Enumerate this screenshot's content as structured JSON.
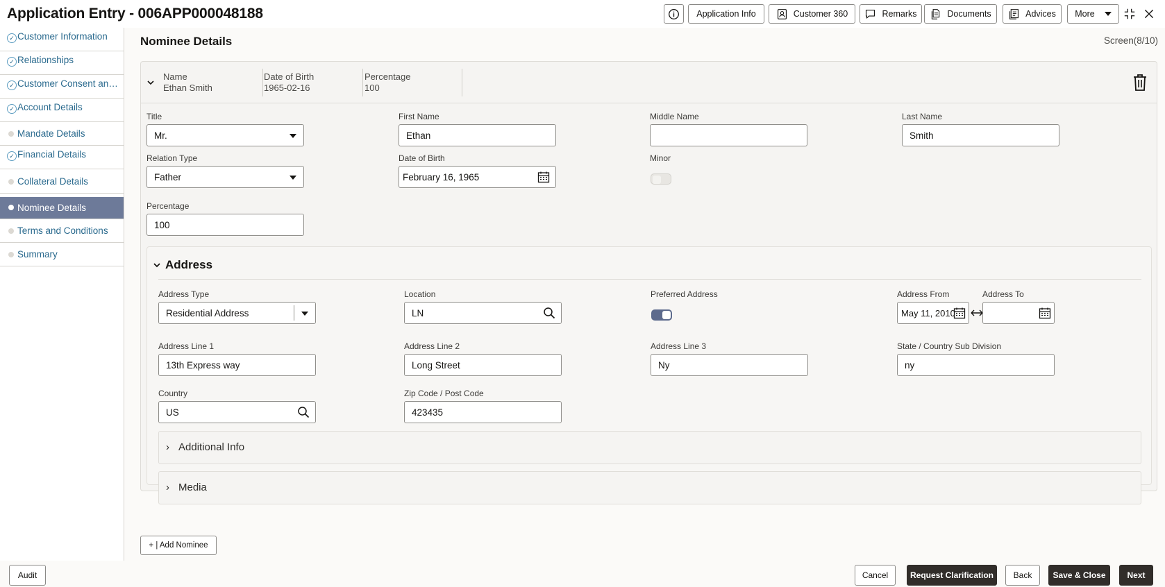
{
  "header": {
    "title": "Application Entry - 006APP000048188",
    "buttons": {
      "info": "",
      "application_info": "Application Info",
      "customer_360": "Customer 360",
      "remarks": "Remarks",
      "documents": "Documents",
      "advices": "Advices",
      "more": "More"
    }
  },
  "sidebar": {
    "items": [
      {
        "label": "Customer Information",
        "state": "done"
      },
      {
        "label": "Relationships",
        "state": "done"
      },
      {
        "label": "Customer Consent and Preferences",
        "state": "done"
      },
      {
        "label": "Account Details",
        "state": "done"
      },
      {
        "label": "Mandate Details",
        "state": "pending"
      },
      {
        "label": "Financial Details",
        "state": "done"
      },
      {
        "label": "Collateral Details",
        "state": "pending"
      },
      {
        "label": "Nominee Details",
        "state": "active"
      },
      {
        "label": "Terms and Conditions",
        "state": "pending"
      },
      {
        "label": "Summary",
        "state": "pending"
      }
    ]
  },
  "main": {
    "page_title": "Nominee Details",
    "screen_indicator": "Screen(8/10)",
    "nominee_summary": {
      "name_label": "Name",
      "name_value": "Ethan Smith",
      "dob_label": "Date of Birth",
      "dob_value": "1965-02-16",
      "pct_label": "Percentage",
      "pct_value": "100"
    },
    "form": {
      "title": {
        "label": "Title",
        "value": "Mr."
      },
      "first_name": {
        "label": "First Name",
        "value": "Ethan"
      },
      "middle_name": {
        "label": "Middle Name",
        "value": ""
      },
      "last_name": {
        "label": "Last Name",
        "value": "Smith"
      },
      "relation_type": {
        "label": "Relation Type",
        "value": "Father"
      },
      "date_of_birth": {
        "label": "Date of Birth",
        "value": "February 16, 1965"
      },
      "minor": {
        "label": "Minor",
        "on": false
      },
      "percentage": {
        "label": "Percentage",
        "value": "100"
      }
    },
    "address": {
      "section_title": "Address",
      "address_type": {
        "label": "Address Type",
        "value": "Residential Address"
      },
      "location": {
        "label": "Location",
        "value": "LN"
      },
      "preferred": {
        "label": "Preferred Address",
        "on": true
      },
      "address_from": {
        "label": "Address From",
        "value": "May 11, 2010"
      },
      "address_to": {
        "label": "Address To",
        "value": ""
      },
      "line1": {
        "label": "Address Line 1",
        "value": "13th Express way"
      },
      "line2": {
        "label": "Address Line 2",
        "value": "Long Street"
      },
      "line3": {
        "label": "Address Line 3",
        "value": "Ny"
      },
      "state": {
        "label": "State / Country Sub Division",
        "value": "ny"
      },
      "country": {
        "label": "Country",
        "value": "US"
      },
      "zip": {
        "label": "Zip Code / Post Code",
        "value": "423435"
      },
      "additional_info": "Additional Info",
      "media": "Media"
    },
    "add_nominee": "+ | Add Nominee"
  },
  "footer": {
    "audit": "Audit",
    "cancel": "Cancel",
    "request_clarification": "Request Clarification",
    "back": "Back",
    "save_close": "Save & Close",
    "next": "Next"
  },
  "colors": {
    "active_nav": "#6d7a99",
    "link": "#2a6a8e",
    "primary_button": "#312d2a",
    "toggle_on": "#5d6b8d"
  }
}
